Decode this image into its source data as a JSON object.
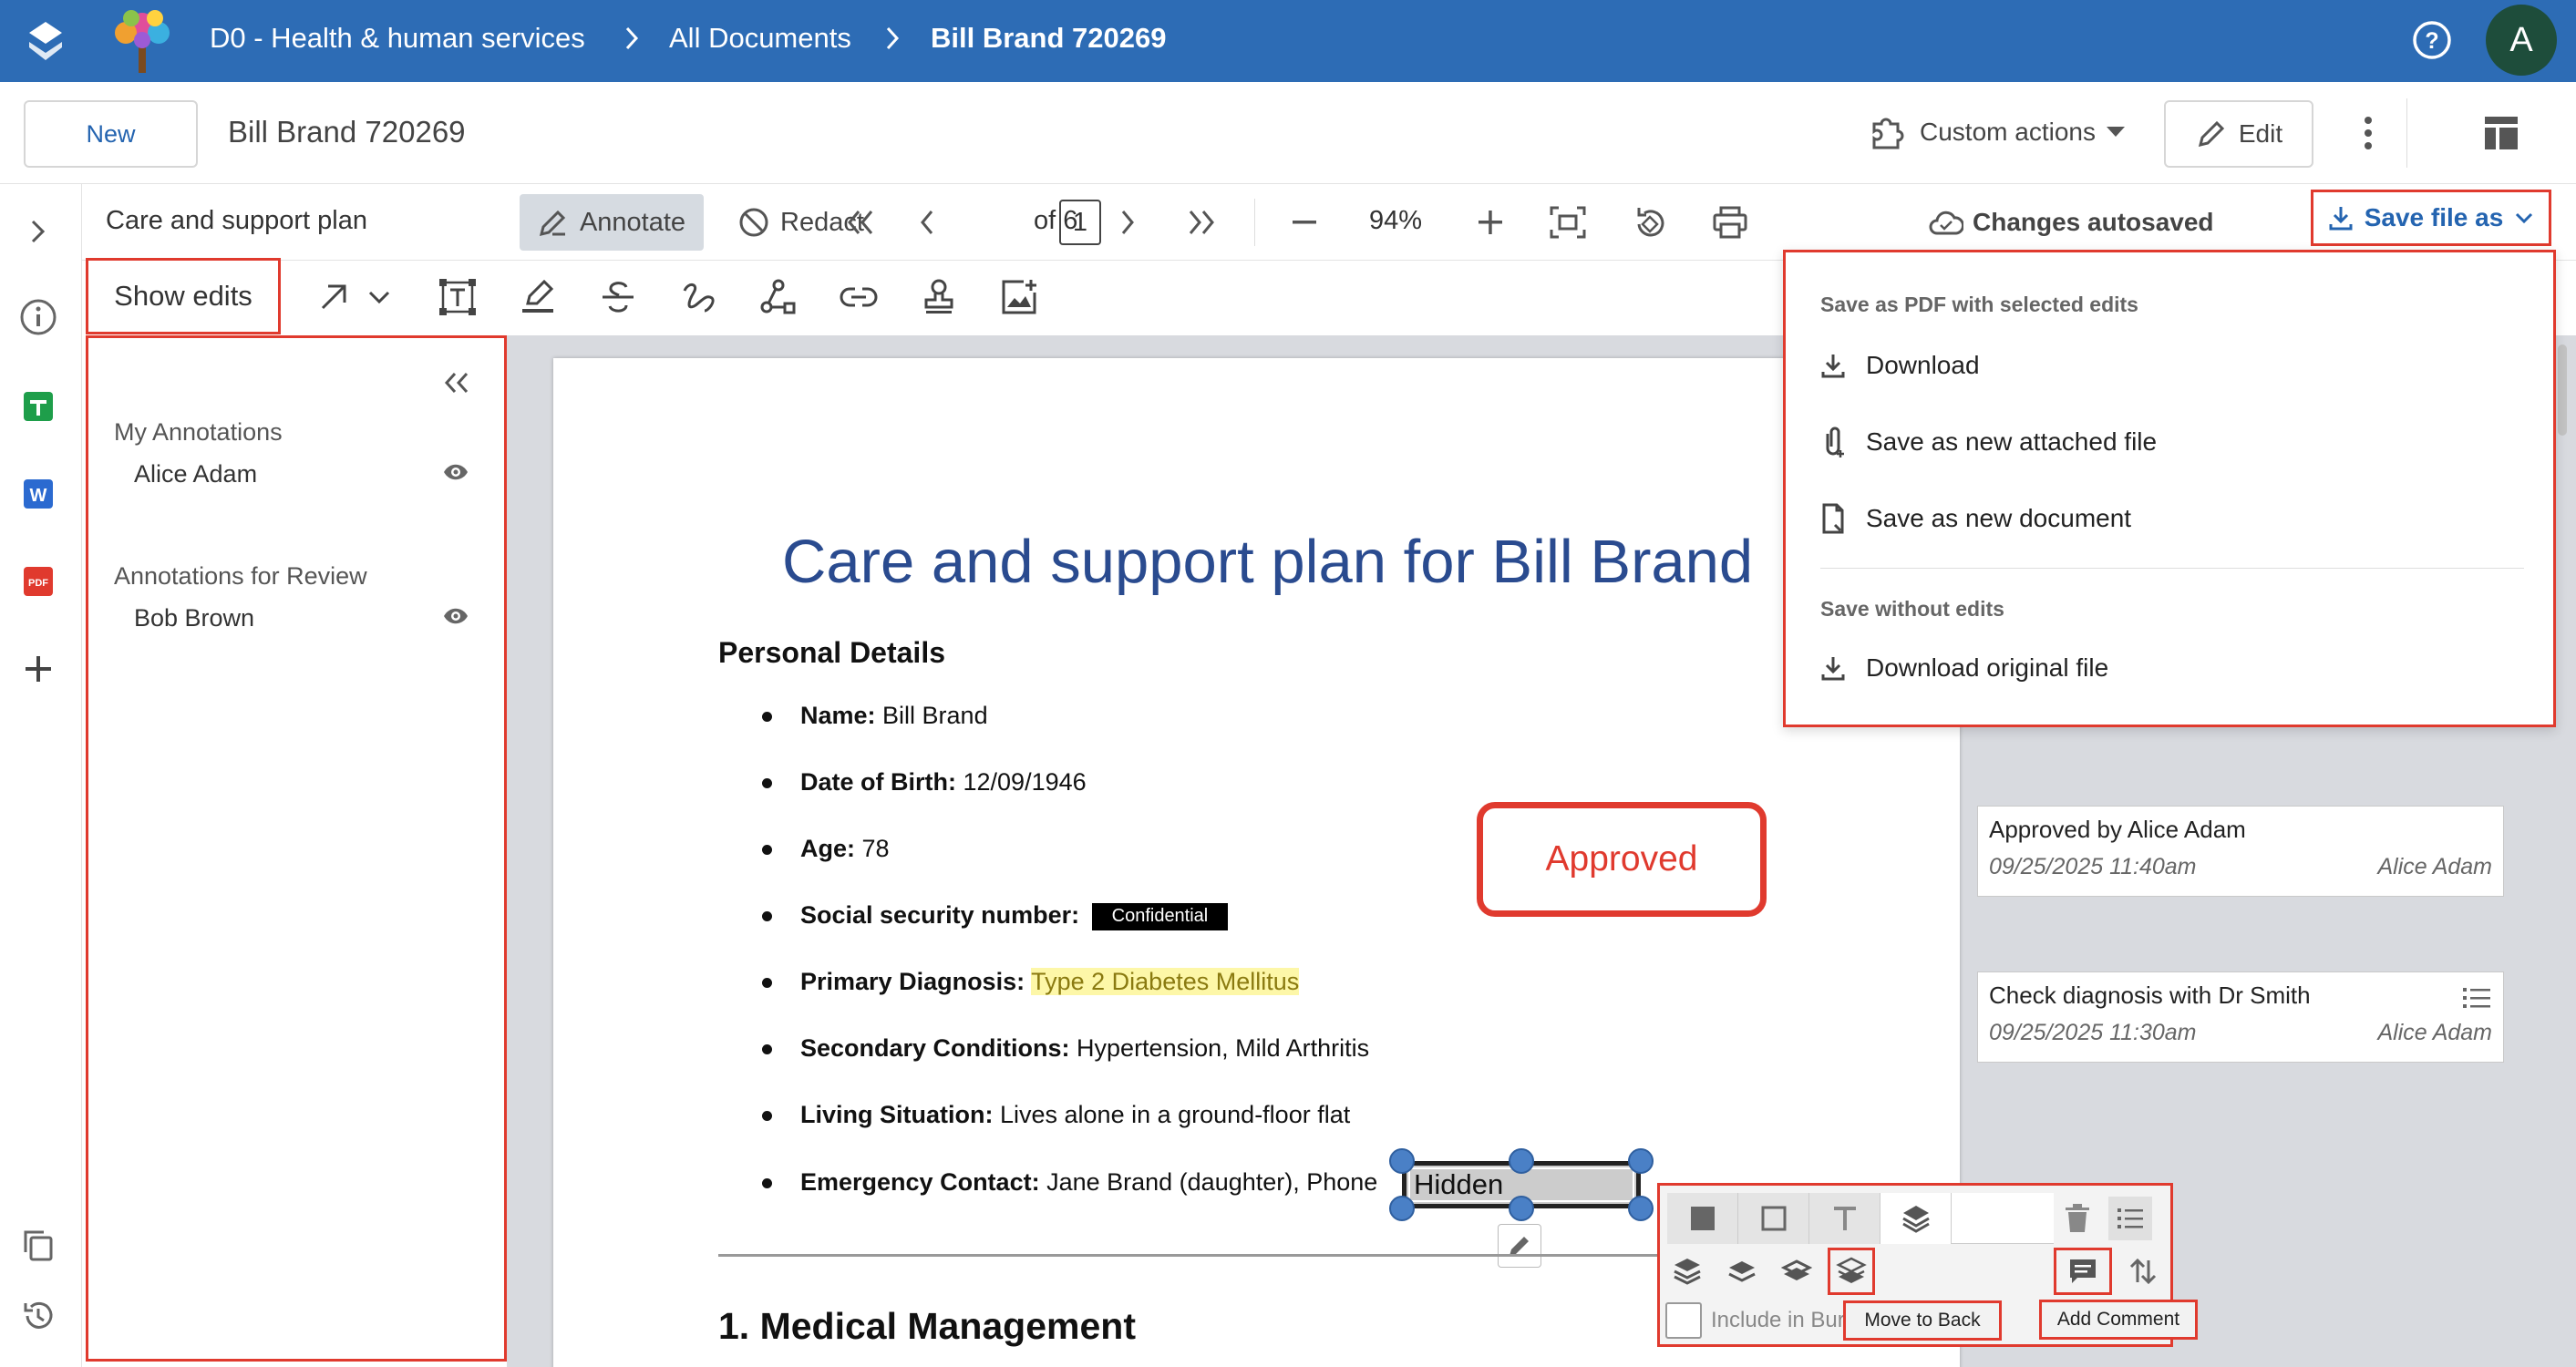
{
  "topbar": {
    "breadcrumb": [
      "D0 - Health & human services",
      "All Documents",
      "Bill Brand 720269"
    ],
    "user_initial": "A",
    "colors": {
      "bar": "#2d6cb5",
      "avatar": "#1e4d3b"
    }
  },
  "header": {
    "new_label": "New",
    "doc_title": "Bill Brand 720269",
    "custom_actions_label": "Custom actions",
    "edit_label": "Edit"
  },
  "toolbar": {
    "doc_name": "Care and support plan",
    "annotate_label": "Annotate",
    "redact_label": "Redact",
    "page_current": "1",
    "page_total": "of 6",
    "zoom": "94%",
    "status": "Changes autosaved",
    "save_file_as_label": "Save file as"
  },
  "toolbar2": {
    "show_edits_label": "Show edits",
    "tools": [
      "arrow-icon",
      "chevron-down-icon",
      "textbox-icon",
      "highlighter-icon",
      "strikethrough-icon",
      "freehand-icon",
      "shape-icon",
      "link-icon",
      "stamp-icon",
      "add-image-icon"
    ]
  },
  "sidepanel": {
    "my_heading": "My Annotations",
    "my_user": "Alice Adam",
    "review_heading": "Annotations for Review",
    "review_user": "Bob Brown"
  },
  "document": {
    "title": "Care and support plan for Bill Brand",
    "section_heading": "Personal Details",
    "items": [
      {
        "label": "Name:",
        "value": " Bill Brand"
      },
      {
        "label": "Date of Birth:",
        "value": " 12/09/1946"
      },
      {
        "label": "Age:",
        "value": " 78"
      },
      {
        "label": "Social security number:",
        "value": "",
        "badge": "Confidential"
      },
      {
        "label": "Primary Diagnosis:",
        "value": "",
        "highlight": "Type 2 Diabetes Mellitus"
      },
      {
        "label": "Secondary Conditions:",
        "value": " Hypertension, Mild Arthritis"
      },
      {
        "label": "Living Situation:",
        "value": " Lives alone in a ground-floor flat"
      },
      {
        "label": "Emergency Contact:",
        "value": " Jane Brand (daughter), Phone"
      }
    ],
    "redaction_text": "Hidden",
    "stamp_text": "Approved",
    "next_heading": "1. Medical Management"
  },
  "comments": [
    {
      "text": "Approved by Alice Adam",
      "date": "09/25/2025 11:40am",
      "author": "Alice Adam"
    },
    {
      "text": "Check diagnosis with Dr Smith",
      "date": "09/25/2025 11:30am",
      "author": "Alice Adam"
    }
  ],
  "save_menu": {
    "section1": "Save as PDF with selected edits",
    "download": "Download",
    "save_attached": "Save as new attached file",
    "save_document": "Save as new document",
    "section2": "Save without edits",
    "download_original": "Download original file"
  },
  "annotation_panel": {
    "include_label": "Include in Burn",
    "move_to_back_tooltip": "Move to Back",
    "add_comment_tooltip": "Add Comment"
  },
  "rail": [
    "chevron-right-icon",
    "info-icon",
    "spreadsheet-icon",
    "word-icon",
    "pdf-icon",
    "plus-icon",
    "copy-icon",
    "history-icon"
  ]
}
